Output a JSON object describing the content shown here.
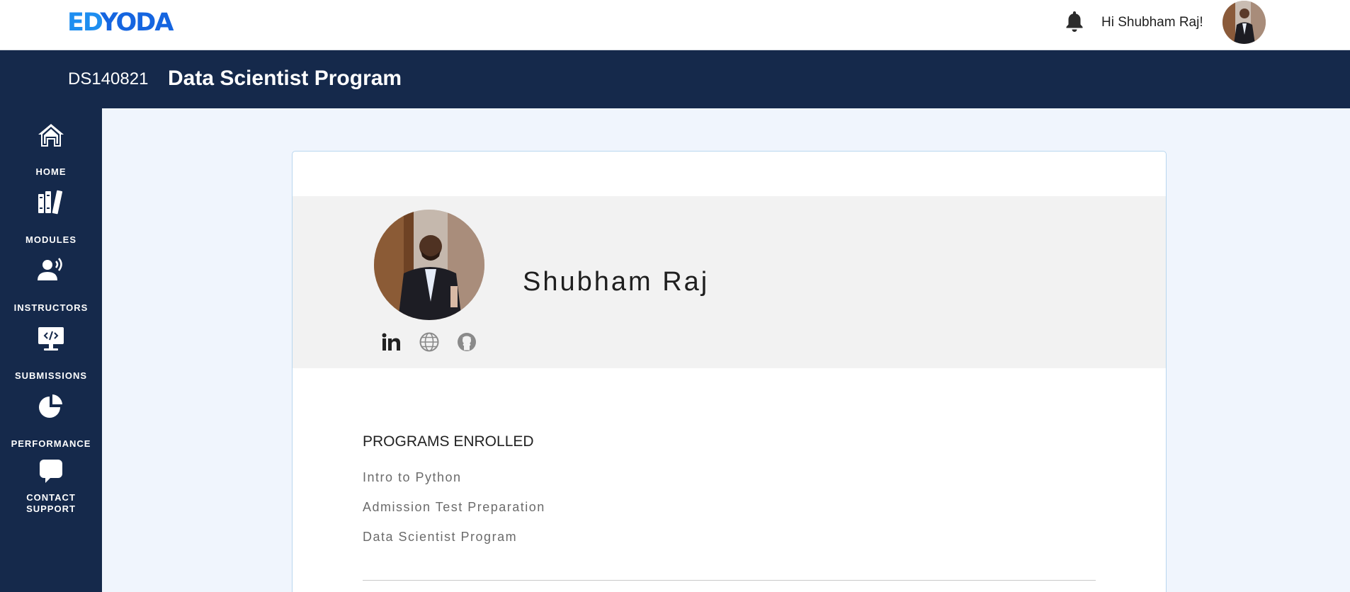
{
  "header": {
    "logo": {
      "part1": "ED",
      "part2": "YODA"
    },
    "greeting": "Hi Shubham Raj!"
  },
  "program": {
    "code": "DS140821",
    "title": "Data Scientist Program"
  },
  "sidebar": {
    "items": [
      {
        "label": "HOME",
        "icon": "home-icon"
      },
      {
        "label": "MODULES",
        "icon": "books-icon"
      },
      {
        "label": "INSTRUCTORS",
        "icon": "speaker-icon"
      },
      {
        "label": "SUBMISSIONS",
        "icon": "monitor-code-icon"
      },
      {
        "label": "PERFORMANCE",
        "icon": "pie-chart-icon"
      },
      {
        "label_line1": "CONTACT",
        "label_line2": "SUPPORT",
        "icon": "chat-icon"
      }
    ]
  },
  "profile": {
    "name": "Shubham Raj",
    "socials": [
      "linkedin-icon",
      "globe-icon",
      "github-icon"
    ]
  },
  "programs_enrolled": {
    "title": "PROGRAMS ENROLLED",
    "items": [
      "Intro to Python",
      "Admission Test Preparation",
      "Data Scientist Program"
    ]
  },
  "colors": {
    "navy": "#15294b",
    "logo_light": "#1e8ef0",
    "logo_dark": "#1565e0",
    "page_bg": "#f0f5fd",
    "band_bg": "#f2f2f2"
  }
}
